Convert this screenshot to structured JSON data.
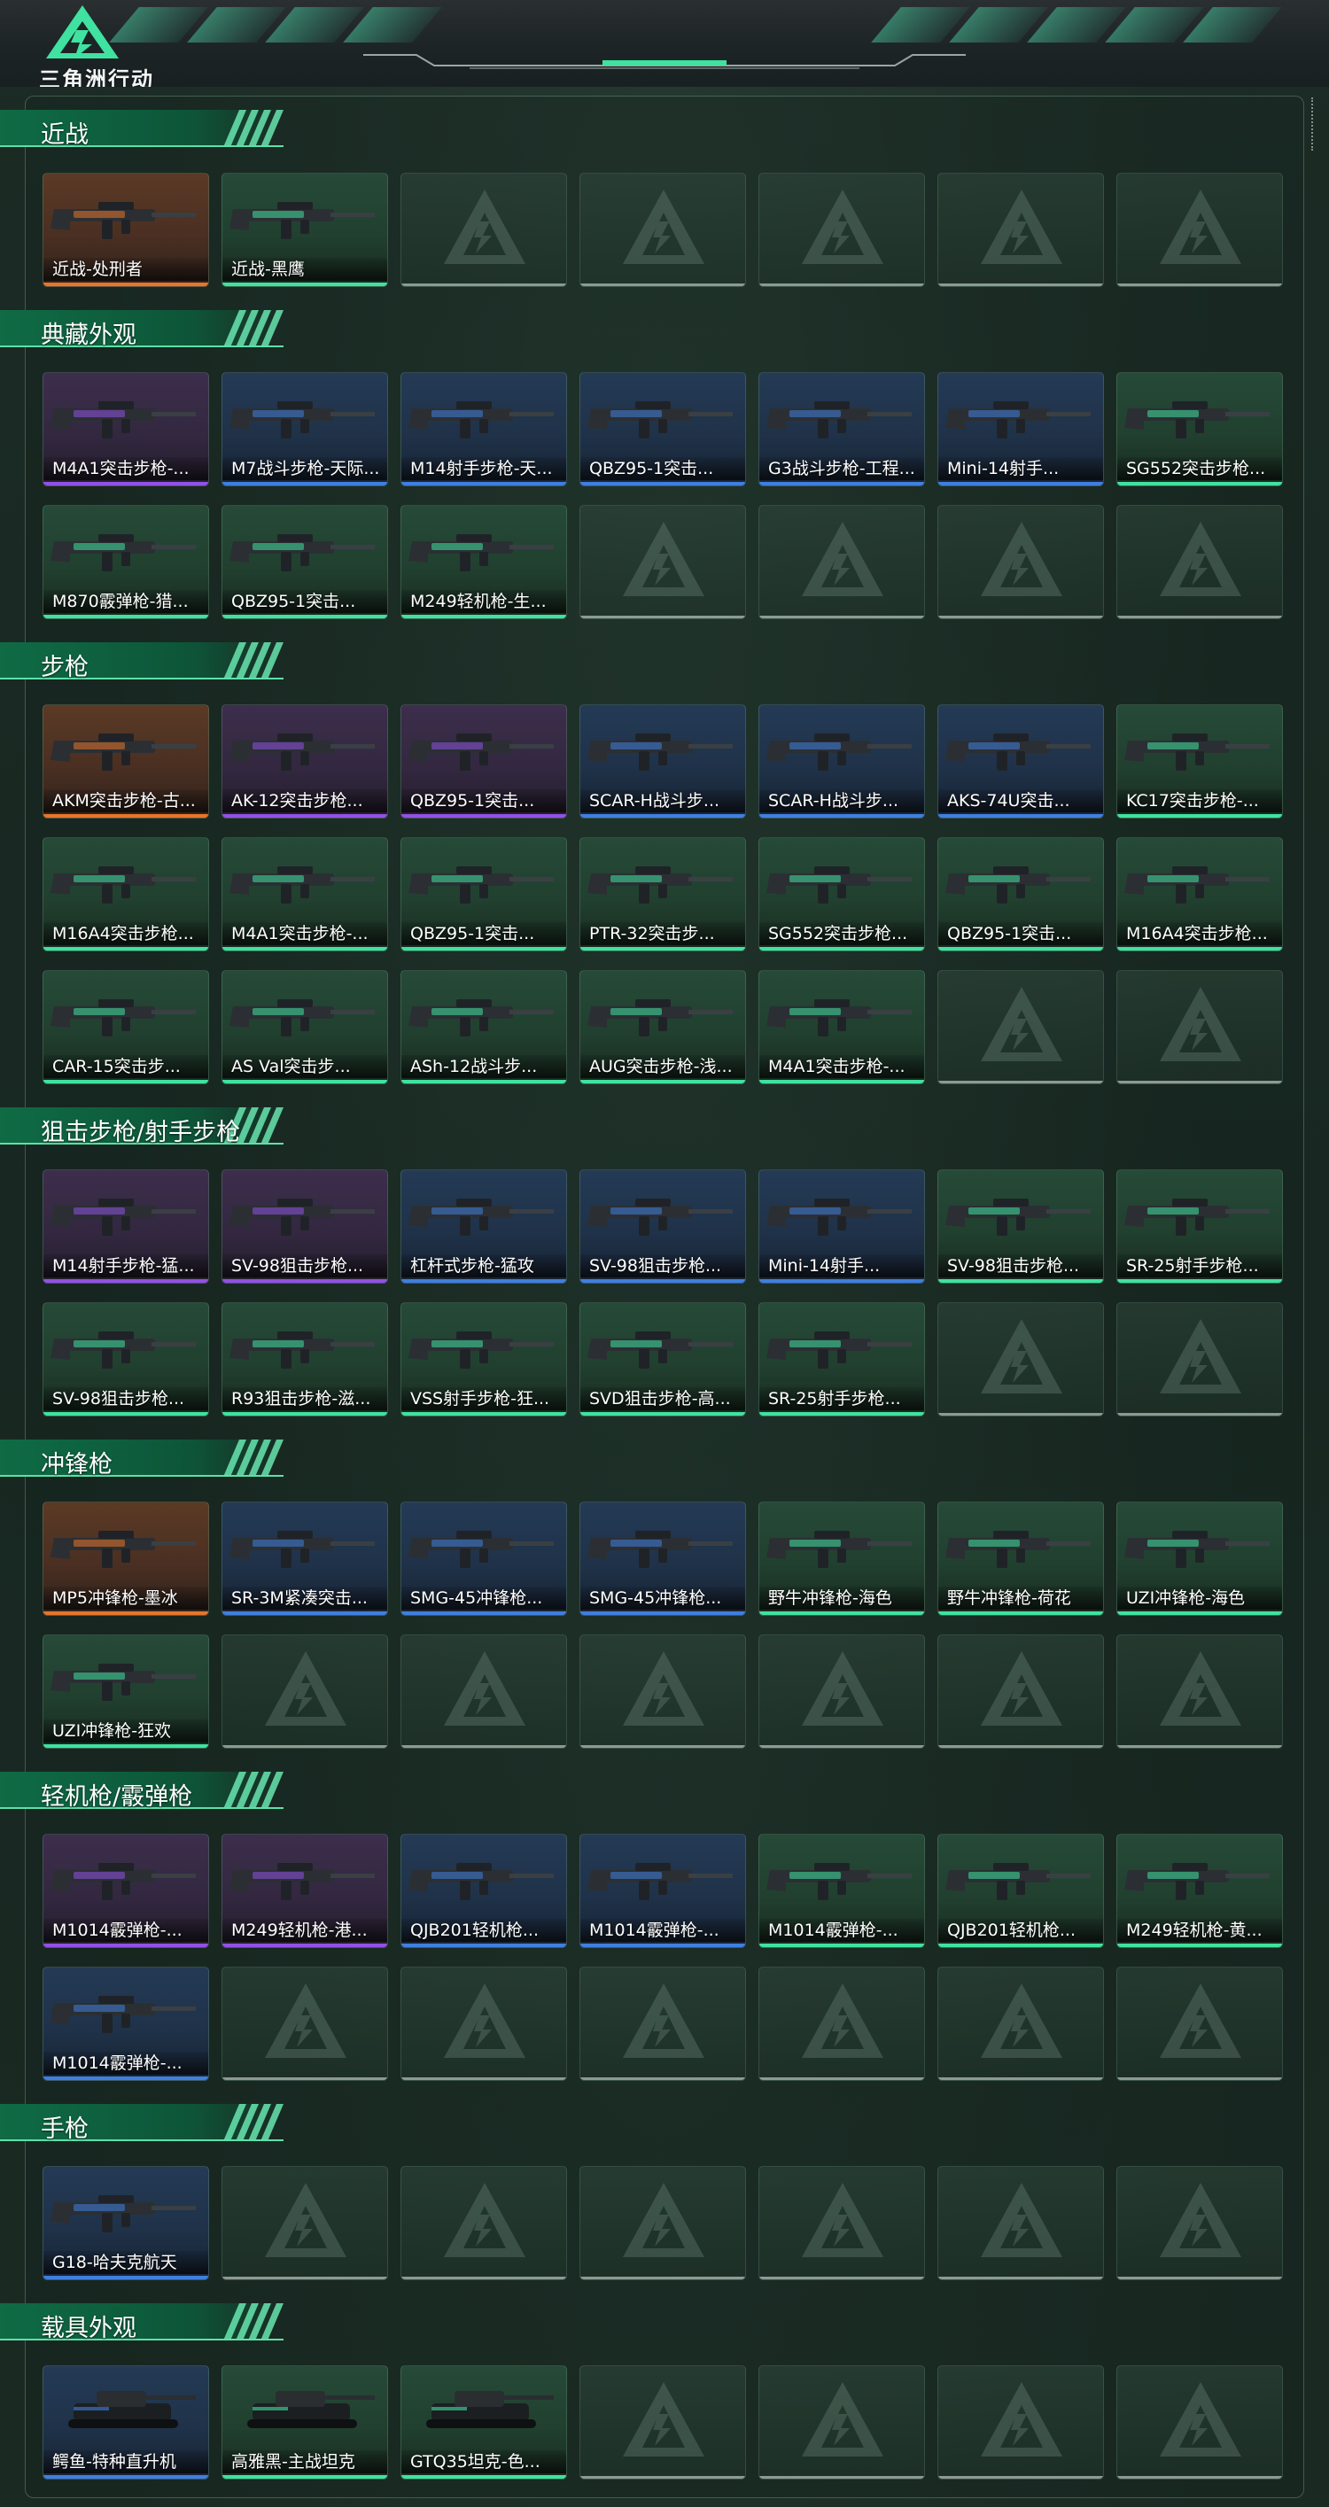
{
  "header": {
    "title": "三角洲行动"
  },
  "sections": [
    {
      "title": "近战",
      "rows": [
        [
          {
            "label": "近战-处刑者",
            "rarity": "orange"
          },
          {
            "label": "近战-黑鹰",
            "rarity": "green"
          }
        ]
      ]
    },
    {
      "title": "典藏外观",
      "rows": [
        [
          {
            "label": "M4A1突击步枪-...",
            "rarity": "purple"
          },
          {
            "label": "M7战斗步枪-天际...",
            "rarity": "blue"
          },
          {
            "label": "M14射手步枪-天...",
            "rarity": "blue"
          },
          {
            "label": "QBZ95-1突击...",
            "rarity": "blue"
          },
          {
            "label": "G3战斗步枪-工程...",
            "rarity": "blue"
          },
          {
            "label": "Mini-14射手...",
            "rarity": "blue"
          },
          {
            "label": "SG552突击步枪...",
            "rarity": "green"
          }
        ],
        [
          {
            "label": "M870霰弹枪-猎...",
            "rarity": "green"
          },
          {
            "label": "QBZ95-1突击...",
            "rarity": "green"
          },
          {
            "label": "M249轻机枪-生...",
            "rarity": "green"
          }
        ]
      ]
    },
    {
      "title": "步枪",
      "rows": [
        [
          {
            "label": "AKM突击步枪-古...",
            "rarity": "orange"
          },
          {
            "label": "AK-12突击步枪...",
            "rarity": "purple"
          },
          {
            "label": "QBZ95-1突击...",
            "rarity": "purple"
          },
          {
            "label": "SCAR-H战斗步...",
            "rarity": "blue"
          },
          {
            "label": "SCAR-H战斗步...",
            "rarity": "blue"
          },
          {
            "label": "AKS-74U突击...",
            "rarity": "blue"
          },
          {
            "label": "KC17突击步枪-...",
            "rarity": "green"
          }
        ],
        [
          {
            "label": "M16A4突击步枪...",
            "rarity": "green"
          },
          {
            "label": "M4A1突击步枪-...",
            "rarity": "green"
          },
          {
            "label": "QBZ95-1突击...",
            "rarity": "green"
          },
          {
            "label": "PTR-32突击步...",
            "rarity": "green"
          },
          {
            "label": "SG552突击步枪...",
            "rarity": "green"
          },
          {
            "label": "QBZ95-1突击...",
            "rarity": "green"
          },
          {
            "label": "M16A4突击步枪...",
            "rarity": "green"
          }
        ],
        [
          {
            "label": "CAR-15突击步...",
            "rarity": "green"
          },
          {
            "label": "AS Val突击步...",
            "rarity": "green"
          },
          {
            "label": "ASh-12战斗步...",
            "rarity": "green"
          },
          {
            "label": "AUG突击步枪-浅...",
            "rarity": "green"
          },
          {
            "label": "M4A1突击步枪-...",
            "rarity": "green"
          }
        ]
      ]
    },
    {
      "title": "狙击步枪/射手步枪",
      "rows": [
        [
          {
            "label": "M14射手步枪-猛...",
            "rarity": "purple"
          },
          {
            "label": "SV-98狙击步枪...",
            "rarity": "purple"
          },
          {
            "label": "杠杆式步枪-猛攻",
            "rarity": "blue"
          },
          {
            "label": "SV-98狙击步枪...",
            "rarity": "blue"
          },
          {
            "label": "Mini-14射手...",
            "rarity": "blue"
          },
          {
            "label": "SV-98狙击步枪...",
            "rarity": "green"
          },
          {
            "label": "SR-25射手步枪...",
            "rarity": "green"
          }
        ],
        [
          {
            "label": "SV-98狙击步枪...",
            "rarity": "green"
          },
          {
            "label": "R93狙击步枪-滋...",
            "rarity": "green"
          },
          {
            "label": "VSS射手步枪-狂...",
            "rarity": "green"
          },
          {
            "label": "SVD狙击步枪-高...",
            "rarity": "green"
          },
          {
            "label": "SR-25射手步枪...",
            "rarity": "green"
          }
        ]
      ]
    },
    {
      "title": "冲锋枪",
      "rows": [
        [
          {
            "label": "MP5冲锋枪-墨冰",
            "rarity": "orange"
          },
          {
            "label": "SR-3M紧凑突击...",
            "rarity": "blue"
          },
          {
            "label": "SMG-45冲锋枪...",
            "rarity": "blue"
          },
          {
            "label": "SMG-45冲锋枪...",
            "rarity": "blue"
          },
          {
            "label": "野牛冲锋枪-海色",
            "rarity": "green"
          },
          {
            "label": "野牛冲锋枪-荷花",
            "rarity": "green"
          },
          {
            "label": "UZI冲锋枪-海色",
            "rarity": "green"
          }
        ],
        [
          {
            "label": "UZI冲锋枪-狂欢",
            "rarity": "green"
          }
        ]
      ]
    },
    {
      "title": "轻机枪/霰弹枪",
      "rows": [
        [
          {
            "label": "M1014霰弹枪-...",
            "rarity": "purple"
          },
          {
            "label": "M249轻机枪-港...",
            "rarity": "purple"
          },
          {
            "label": "QJB201轻机枪...",
            "rarity": "blue"
          },
          {
            "label": "M1014霰弹枪-...",
            "rarity": "blue"
          },
          {
            "label": "M1014霰弹枪-...",
            "rarity": "green"
          },
          {
            "label": "QJB201轻机枪...",
            "rarity": "green"
          },
          {
            "label": "M249轻机枪-黄...",
            "rarity": "green"
          }
        ],
        [
          {
            "label": "M1014霰弹枪-...",
            "rarity": "blue"
          }
        ]
      ]
    },
    {
      "title": "手枪",
      "rows": [
        [
          {
            "label": "G18-哈夫克航天",
            "rarity": "blue"
          }
        ]
      ]
    },
    {
      "title": "载具外观",
      "rows": [
        [
          {
            "label": "鳄鱼-特种直升机",
            "rarity": "blue"
          },
          {
            "label": "高雅黑-主战坦克",
            "rarity": "green"
          },
          {
            "label": "GTQ35坦克-色...",
            "rarity": "green"
          }
        ]
      ]
    }
  ],
  "rarity_colors": {
    "orange": "#e8752a",
    "purple": "#9251e5",
    "blue": "#3f7fe0",
    "green": "#3fe2a0",
    "empty": "#8d9a94"
  },
  "accent_color": "#5fe0a9"
}
